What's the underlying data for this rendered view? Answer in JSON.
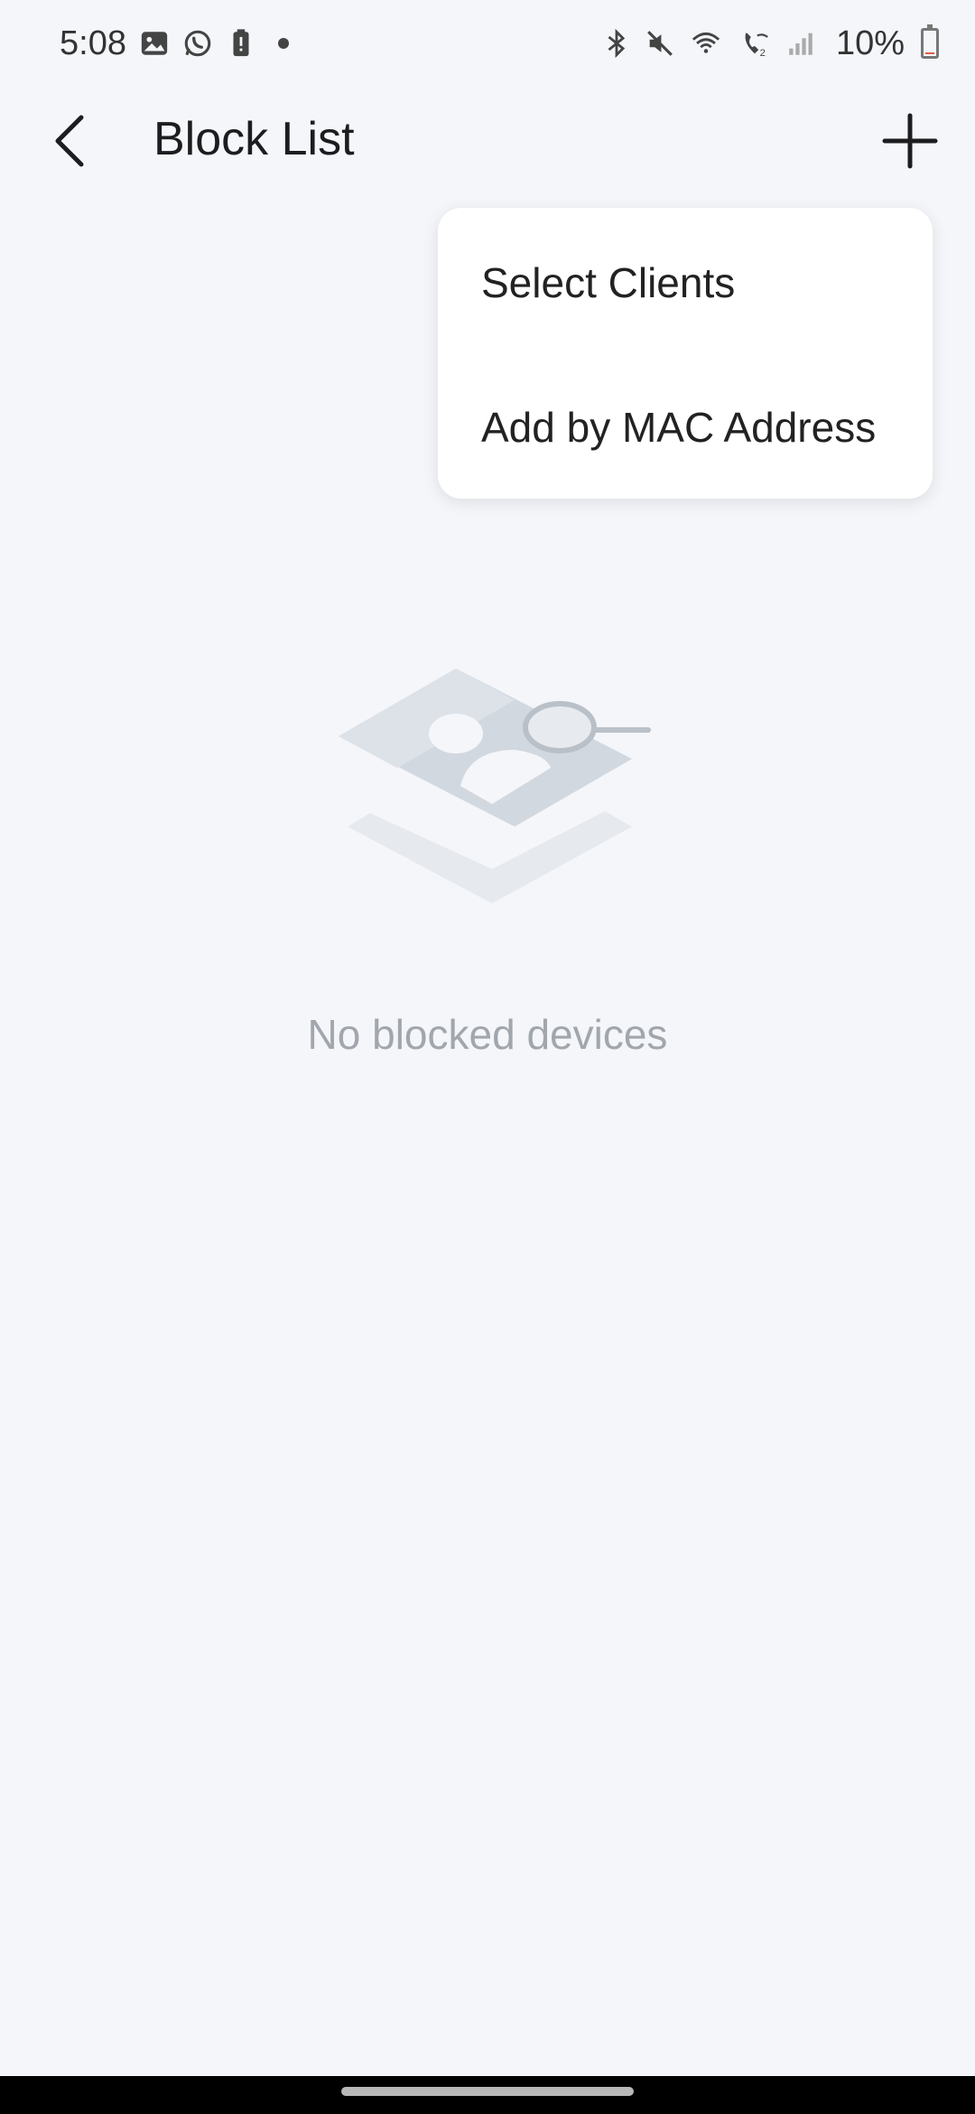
{
  "status_bar": {
    "time": "5:08",
    "battery_percent": "10%",
    "battery_level": 0.1,
    "left_icons": [
      "gallery-icon",
      "whatsapp-icon",
      "battery-alert-icon",
      "notification-dot-icon"
    ],
    "right_icons": [
      "bluetooth-icon",
      "mute-icon",
      "wifi-icon",
      "wifi-calling-icon",
      "signal-icon",
      "battery-icon"
    ]
  },
  "header": {
    "title": "Block List",
    "back_icon": "chevron-left-icon",
    "add_icon": "plus-icon"
  },
  "dropdown": {
    "items": [
      {
        "label": "Select Clients"
      },
      {
        "label": "Add by MAC Address"
      }
    ]
  },
  "empty_state": {
    "message": "No blocked devices",
    "illustration_icon": "search-contact-card-icon"
  },
  "colors": {
    "background": "#f4f6fa",
    "menu_background": "#ffffff",
    "empty_text": "#a2a6ad",
    "battery_low": "#e25a4a"
  }
}
